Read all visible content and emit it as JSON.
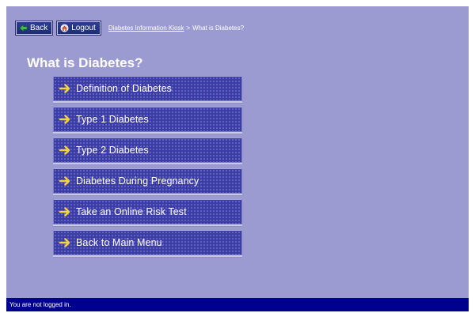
{
  "toolbar": {
    "back_label": "Back",
    "logout_label": "Logout",
    "back_icon": "arrow-left-icon",
    "logout_icon": "home-icon"
  },
  "breadcrumb": {
    "root": "Diabetes Information Kiosk",
    "separator": ">",
    "current": "What is Diabetes?"
  },
  "page": {
    "title": "What is Diabetes?"
  },
  "menu": {
    "icon": "arrow-right-icon",
    "items": [
      {
        "label": "Definition of Diabetes"
      },
      {
        "label": "Type 1 Diabetes"
      },
      {
        "label": "Type 2 Diabetes"
      },
      {
        "label": "Diabetes During Pregnancy"
      },
      {
        "label": "Take an Online Risk Test"
      },
      {
        "label": "Back to Main Menu"
      }
    ]
  },
  "status": {
    "text": "You are not logged in."
  },
  "colors": {
    "background": "#9b9bd2",
    "button": "#3b3ca6",
    "arrow": "#f6d33a",
    "status_bar": "#00008f"
  }
}
